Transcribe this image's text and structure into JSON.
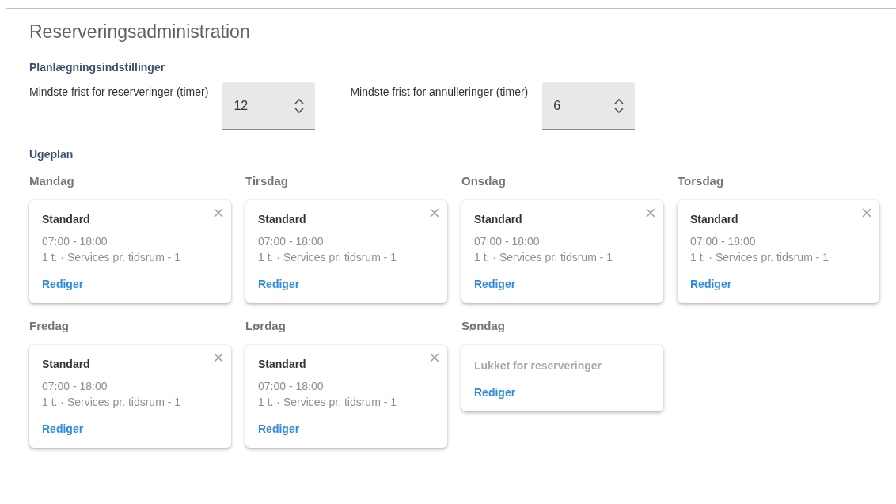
{
  "title": "Reserveringsadministration",
  "settings": {
    "heading": "Planlægningsindstillinger",
    "fields": [
      {
        "label": "Mindste frist for reserveringer (timer)",
        "value": "12"
      },
      {
        "label": "Mindste frist for annulleringer (timer)",
        "value": "6"
      }
    ]
  },
  "weekly": {
    "heading": "Ugeplan",
    "days": [
      {
        "name": "Mandag",
        "kind": "open",
        "title": "Standard",
        "hours": "07:00 - 18:00",
        "detail": "1 t. · Services pr. tidsrum - 1",
        "link": "Rediger"
      },
      {
        "name": "Tirsdag",
        "kind": "open",
        "title": "Standard",
        "hours": "07:00 - 18:00",
        "detail": "1 t. · Services pr. tidsrum - 1",
        "link": "Rediger"
      },
      {
        "name": "Onsdag",
        "kind": "open",
        "title": "Standard",
        "hours": "07:00 - 18:00",
        "detail": "1 t. · Services pr. tidsrum - 1",
        "link": "Rediger"
      },
      {
        "name": "Torsdag",
        "kind": "open",
        "title": "Standard",
        "hours": "07:00 - 18:00",
        "detail": "1 t. · Services pr. tidsrum - 1",
        "link": "Rediger"
      },
      {
        "name": "Fredag",
        "kind": "open",
        "title": "Standard",
        "hours": "07:00 - 18:00",
        "detail": "1 t. · Services pr. tidsrum - 1",
        "link": "Rediger"
      },
      {
        "name": "Lørdag",
        "kind": "open",
        "title": "Standard",
        "hours": "07:00 - 18:00",
        "detail": "1 t. · Services pr. tidsrum - 1",
        "link": "Rediger"
      },
      {
        "name": "Søndag",
        "kind": "closed",
        "title": "Lukket for reserveringer",
        "link": "Rediger"
      }
    ]
  }
}
